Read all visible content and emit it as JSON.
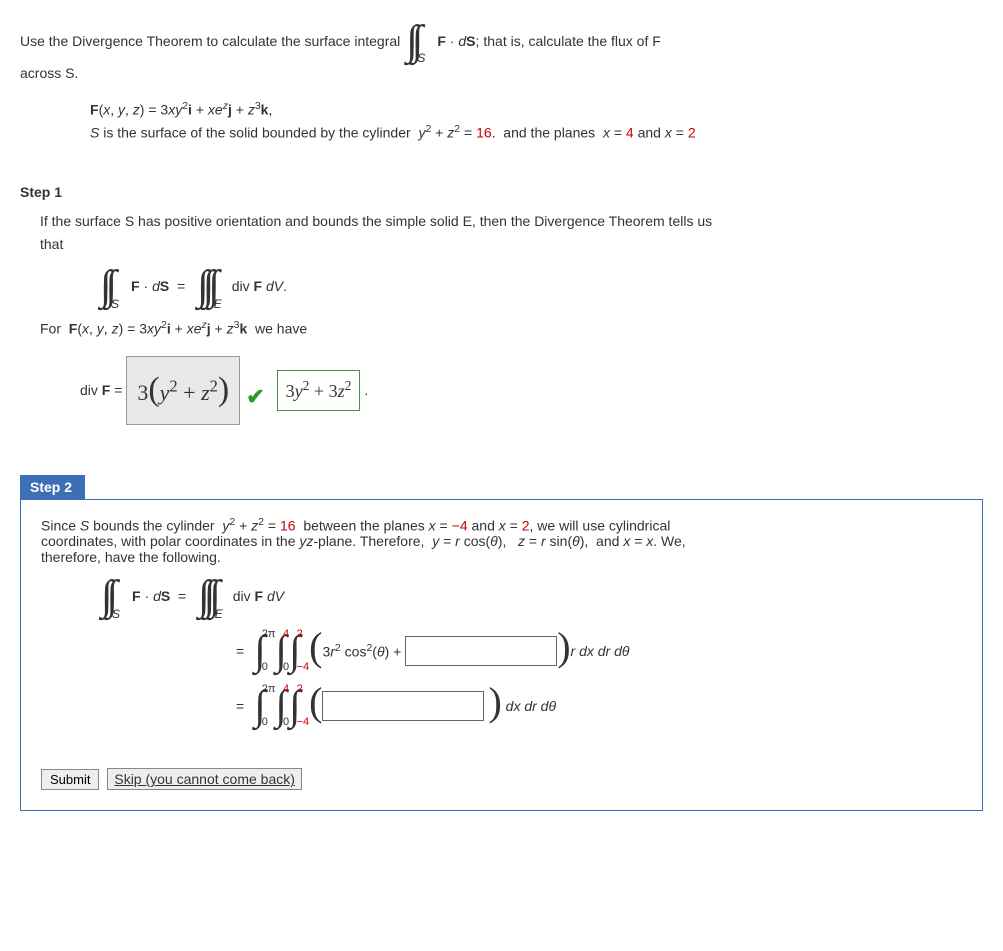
{
  "problem": {
    "intro1": "Use the Divergence Theorem to calculate the surface integral ",
    "flux_expr": "F · dS;",
    "intro2": " that is, calculate the flux of F",
    "intro3": "across S.",
    "F_def_prefix": "F(x, y, z) = ",
    "F_def": "3xy²i + xe^z j + z³k,",
    "S_def_prefix": "S is the surface of the solid bounded by the cylinder  ",
    "cylinder_eq": "y² + z² = ",
    "cylinder_val": "16",
    "S_def_mid": ".  and the planes  x = ",
    "planeA": "4",
    "S_def_and": " and x = ",
    "planeB": "2"
  },
  "step1": {
    "label": "Step 1",
    "text1": "If the surface S has positive orientation and bounds the simple solid E, then the Divergence Theorem tells us",
    "text2": "that",
    "lhs": "F · dS",
    "rhs": "div F dV.",
    "for_text": "For  F(x, y, z) = 3xy²i + xe^z j + z³k  we have",
    "divF_label": "div F = ",
    "answer_entered": "3(y² + z²)",
    "answer_correct": "3y² + 3z²"
  },
  "step2": {
    "label": "Step 2",
    "text_a": "Since S bounds the cylinder  y² + z² = ",
    "val16": "16",
    "text_b": "  between the planes x = ",
    "val_neg4": "−4",
    "text_c": " and x = ",
    "val_2": "2",
    "text_d": ", we will use cylindrical",
    "text_e": "coordinates, with polar coordinates in the yz-plane. Therefore,  y = r cos(θ),   z = r sin(θ),  and x = x. We,",
    "text_f": "therefore, have the following.",
    "lhs": "F · dS",
    "rhs1": "div F dV",
    "int1": {
      "a": "0",
      "b": "2π"
    },
    "int2": {
      "a": "0",
      "b": "4"
    },
    "int3": {
      "a": "−4",
      "b": "2"
    },
    "integrand1_pre": "3r² cos²(θ) + ",
    "integrand1_post": "r dx dr dθ",
    "integrand2_post": "dx dr dθ",
    "submit": "Submit",
    "skip": "Skip (you cannot come back)"
  }
}
